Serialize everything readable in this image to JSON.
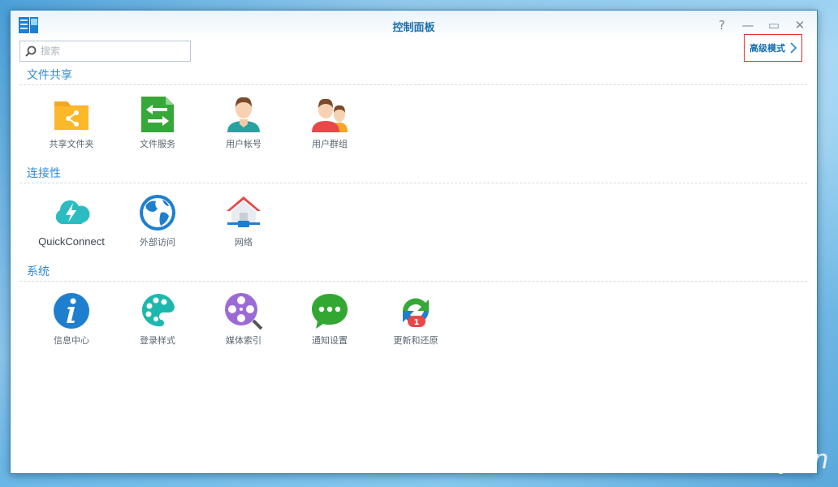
{
  "window": {
    "title": "控制面板",
    "controls": {
      "help": "?",
      "minimize": "—",
      "maximize": "▭",
      "close": "✕"
    }
  },
  "search": {
    "placeholder": "搜索",
    "value": ""
  },
  "advanced_mode": {
    "label": "高级模式"
  },
  "sections": [
    {
      "title": "文件共享",
      "items": [
        {
          "label": "共享文件夹",
          "icon": "shared-folder-icon"
        },
        {
          "label": "文件服务",
          "icon": "file-services-icon"
        },
        {
          "label": "用户帐号",
          "icon": "user-icon"
        },
        {
          "label": "用户群组",
          "icon": "group-icon"
        }
      ]
    },
    {
      "title": "连接性",
      "items": [
        {
          "label": "QuickConnect",
          "icon": "quickconnect-icon"
        },
        {
          "label": "外部访问",
          "icon": "external-access-icon"
        },
        {
          "label": "网络",
          "icon": "network-icon"
        }
      ]
    },
    {
      "title": "系统",
      "items": [
        {
          "label": "信息中心",
          "icon": "info-center-icon"
        },
        {
          "label": "登录样式",
          "icon": "login-style-icon"
        },
        {
          "label": "媒体索引",
          "icon": "media-index-icon"
        },
        {
          "label": "通知设置",
          "icon": "notification-icon"
        },
        {
          "label": "更新和还原",
          "icon": "update-restore-icon",
          "badge": "1"
        }
      ]
    }
  ],
  "watermark": "nasyun",
  "colors": {
    "accent": "#2d8ad6",
    "title": "#1a6fb0",
    "highlight_border": "#e32c2c",
    "badge": "#e84848"
  }
}
